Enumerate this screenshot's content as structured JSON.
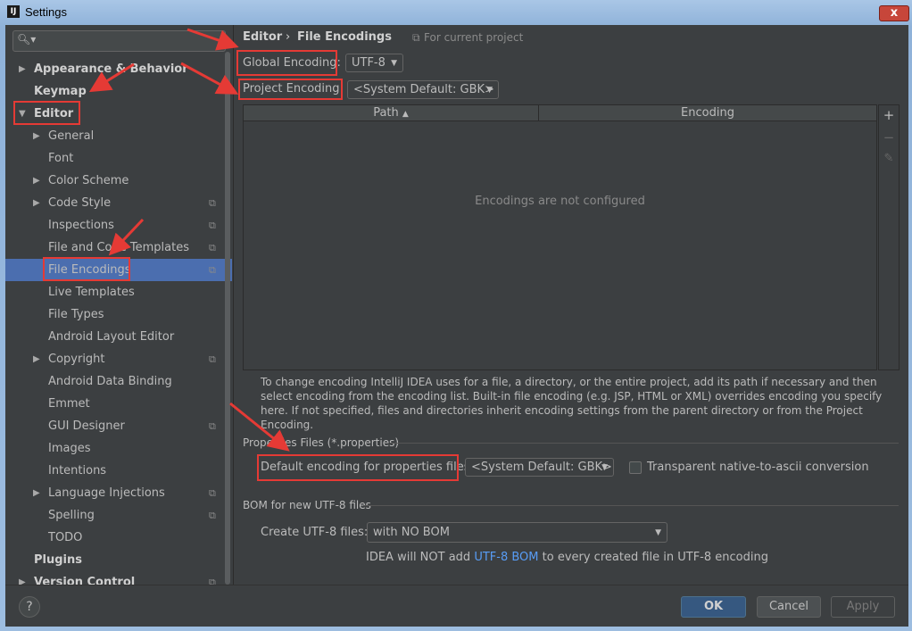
{
  "window": {
    "title": "Settings",
    "icon_text": "IJ",
    "close_label": "x"
  },
  "search": {
    "placeholder": "",
    "icon": "search-icon"
  },
  "sidebar": {
    "items": [
      {
        "label": "Appearance & Behavior",
        "level": 0,
        "arrow": "right",
        "bold": true
      },
      {
        "label": "Keymap",
        "level": 0,
        "arrow": "",
        "bold": true
      },
      {
        "label": "Editor",
        "level": 0,
        "arrow": "down",
        "bold": true
      },
      {
        "label": "General",
        "level": 1,
        "arrow": "right"
      },
      {
        "label": "Font",
        "level": 1,
        "arrow": ""
      },
      {
        "label": "Color Scheme",
        "level": 1,
        "arrow": "right"
      },
      {
        "label": "Code Style",
        "level": 1,
        "arrow": "right",
        "project": true
      },
      {
        "label": "Inspections",
        "level": 1,
        "arrow": "",
        "project": true
      },
      {
        "label": "File and Code Templates",
        "level": 1,
        "arrow": "",
        "project": true
      },
      {
        "label": "File Encodings",
        "level": 1,
        "arrow": "",
        "project": true,
        "selected": true
      },
      {
        "label": "Live Templates",
        "level": 1,
        "arrow": ""
      },
      {
        "label": "File Types",
        "level": 1,
        "arrow": ""
      },
      {
        "label": "Android Layout Editor",
        "level": 1,
        "arrow": ""
      },
      {
        "label": "Copyright",
        "level": 1,
        "arrow": "right",
        "project": true
      },
      {
        "label": "Android Data Binding",
        "level": 1,
        "arrow": ""
      },
      {
        "label": "Emmet",
        "level": 1,
        "arrow": ""
      },
      {
        "label": "GUI Designer",
        "level": 1,
        "arrow": "",
        "project": true
      },
      {
        "label": "Images",
        "level": 1,
        "arrow": ""
      },
      {
        "label": "Intentions",
        "level": 1,
        "arrow": ""
      },
      {
        "label": "Language Injections",
        "level": 1,
        "arrow": "right",
        "project": true
      },
      {
        "label": "Spelling",
        "level": 1,
        "arrow": "",
        "project": true
      },
      {
        "label": "TODO",
        "level": 1,
        "arrow": ""
      },
      {
        "label": "Plugins",
        "level": 0,
        "arrow": "",
        "bold": true
      },
      {
        "label": "Version Control",
        "level": 0,
        "arrow": "right",
        "bold": true,
        "project": true
      }
    ]
  },
  "content": {
    "breadcrumb": {
      "parent": "Editor",
      "separator": "›",
      "current": "File Encodings",
      "scope": "For current project"
    },
    "global_encoding": {
      "label": "Global Encoding:",
      "value": "UTF-8"
    },
    "project_encoding": {
      "label": "Project Encoding:",
      "value": "<System Default: GBK>"
    },
    "table": {
      "columns": [
        "Path",
        "Encoding"
      ],
      "sort_indicator": "▲",
      "empty_text": "Encodings are not configured",
      "tools": [
        "+",
        "−",
        "✎"
      ]
    },
    "help_text": "To change encoding IntelliJ IDEA uses for a file, a directory, or the entire project, add its path if necessary and then select encoding from the encoding list. Built-in file encoding (e.g. JSP, HTML or XML) overrides encoding you specify here. If not specified, files and directories inherit encoding settings from the parent directory or from the Project Encoding.",
    "properties_section": {
      "title": "Properties Files (*.properties)",
      "default_label": "Default encoding for properties files:",
      "default_value": "<System Default: GBK>",
      "native_ascii_label": "Transparent native-to-ascii conversion",
      "native_ascii_checked": false
    },
    "bom_section": {
      "title": "BOM for new UTF-8 files",
      "create_label": "Create UTF-8 files:",
      "create_value": "with NO BOM",
      "note_prefix": "IDEA will NOT add",
      "note_link": "UTF-8 BOM",
      "note_suffix": "to every created file in UTF-8 encoding"
    }
  },
  "footer": {
    "help": "?",
    "ok": "OK",
    "cancel": "Cancel",
    "apply": "Apply"
  },
  "colors": {
    "annotation_red": "#e53a35",
    "selection": "#4b6eaf",
    "link": "#589df6",
    "background": "#3c3f41"
  }
}
